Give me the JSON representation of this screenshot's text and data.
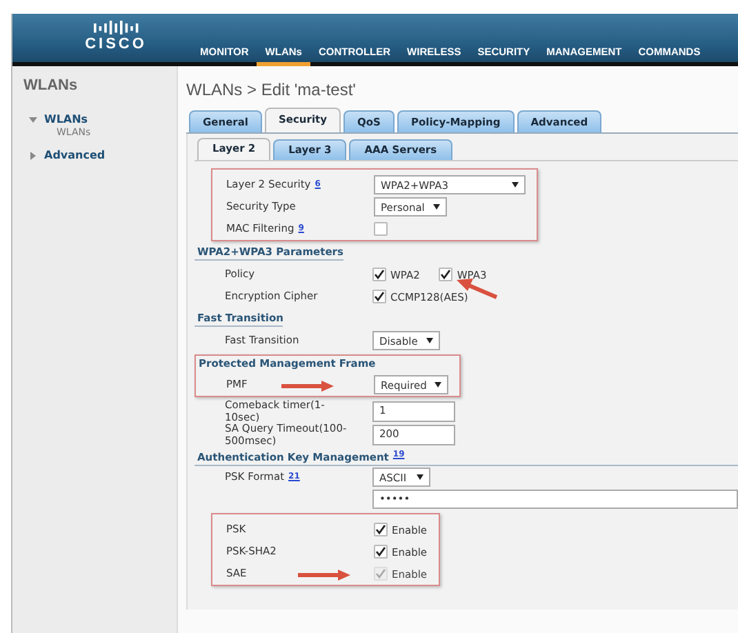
{
  "brand": {
    "name": "CISCO"
  },
  "nav": [
    {
      "label": "MONITOR",
      "selected": false
    },
    {
      "label": "WLANs",
      "selected": true
    },
    {
      "label": "CONTROLLER",
      "selected": false
    },
    {
      "label": "WIRELESS",
      "selected": false
    },
    {
      "label": "SECURITY",
      "selected": false
    },
    {
      "label": "MANAGEMENT",
      "selected": false
    },
    {
      "label": "COMMANDS",
      "selected": false
    }
  ],
  "sidebar": {
    "title": "WLANs",
    "items": [
      {
        "label": "WLANs",
        "expanded": true,
        "children": [
          {
            "label": "WLANs"
          }
        ]
      },
      {
        "label": "Advanced",
        "expanded": false
      }
    ]
  },
  "page_title": "WLANs > Edit  'ma-test'",
  "tabs": [
    {
      "label": "General",
      "selected": false
    },
    {
      "label": "Security",
      "selected": true
    },
    {
      "label": "QoS",
      "selected": false
    },
    {
      "label": "Policy-Mapping",
      "selected": false
    },
    {
      "label": "Advanced",
      "selected": false
    }
  ],
  "subtabs": [
    {
      "label": "Layer 2",
      "selected": true
    },
    {
      "label": "Layer 3",
      "selected": false
    },
    {
      "label": "AAA Servers",
      "selected": false
    }
  ],
  "blocks": [
    {
      "highlighted": true,
      "rows": [
        {
          "kind": "select",
          "label": "Layer 2 Security",
          "footnote": "6",
          "value": "WPA2+WPA3"
        },
        {
          "kind": "select",
          "label": "Security Type",
          "value": "Personal"
        },
        {
          "kind": "checkbox",
          "label": "MAC Filtering",
          "footnote": "9",
          "options": [
            {
              "checked": false,
              "disabled": false
            }
          ]
        }
      ]
    },
    {
      "heading": "WPA2+WPA3 Parameters",
      "highlighted": false,
      "rows": [
        {
          "kind": "checkbox",
          "label": "Policy",
          "options": [
            {
              "label": "WPA2",
              "checked": true,
              "disabled": false
            },
            {
              "label": "WPA3",
              "checked": true,
              "disabled": false
            }
          ],
          "pointer": {
            "kind": "lower-right"
          }
        },
        {
          "kind": "checkbox",
          "label": "Encryption Cipher",
          "options": [
            {
              "label": "CCMP128(AES)",
              "checked": true,
              "disabled": false
            }
          ]
        }
      ]
    },
    {
      "heading": "Fast Transition",
      "highlighted": false,
      "rows": [
        {
          "kind": "select",
          "label": "Fast Transition",
          "value": "Disable"
        }
      ]
    },
    {
      "heading": "Protected Management Frame",
      "highlighted": true,
      "rows": [
        {
          "kind": "select",
          "label": "PMF",
          "value": "Required",
          "pointer": {
            "kind": "left"
          }
        }
      ]
    },
    {
      "highlighted": false,
      "rows": [
        {
          "kind": "input",
          "label": "Comeback timer(1-10sec)",
          "value": "1"
        },
        {
          "kind": "input",
          "label": "SA Query Timeout(100-500msec)",
          "value": "200"
        }
      ]
    },
    {
      "heading": "Authentication Key Management",
      "footnote": "19",
      "highlighted": false,
      "rows": [
        {
          "kind": "select",
          "label": "PSK Format",
          "footnote": "21",
          "value": "ASCII"
        },
        {
          "kind": "password",
          "value": "•••••"
        }
      ]
    },
    {
      "highlighted": true,
      "rows": [
        {
          "kind": "checkbox",
          "label": "PSK",
          "options": [
            {
              "label": "Enable",
              "checked": true,
              "disabled": false
            }
          ]
        },
        {
          "kind": "checkbox",
          "label": "PSK-SHA2",
          "options": [
            {
              "label": "Enable",
              "checked": true,
              "disabled": false
            }
          ]
        },
        {
          "kind": "checkbox",
          "label": "SAE",
          "options": [
            {
              "label": "Enable",
              "checked": true,
              "disabled": true
            }
          ],
          "pointer": {
            "kind": "left"
          }
        }
      ]
    }
  ]
}
